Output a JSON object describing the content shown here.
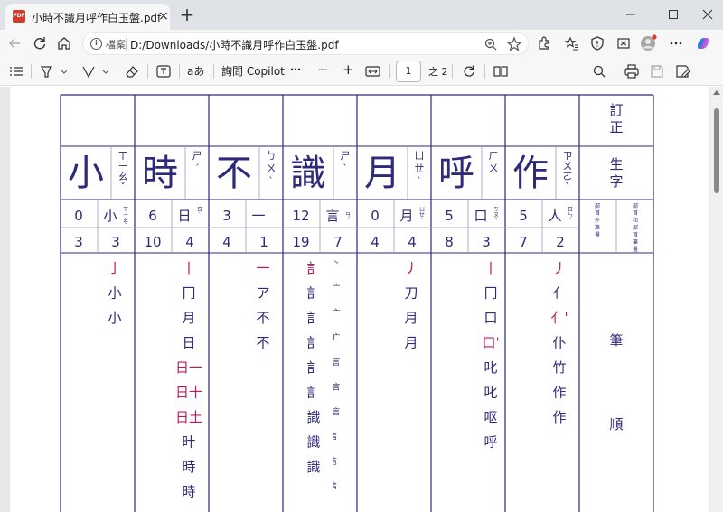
{
  "browser": {
    "tab_title": "小時不識月呼作白玉盤.pdf",
    "tab_icon": "pdf-icon",
    "new_tab_label": "+",
    "close_label": "×",
    "address_label": "檔案",
    "url": "D:/Downloads/小時不識月呼作白玉盤.pdf"
  },
  "pdf_toolbar": {
    "read_aloud_label": "aあ",
    "copilot_label": "詢問 Copilot",
    "more_label": "⋯",
    "zoom_out_label": "−",
    "zoom_in_label": "+",
    "page_number": "1",
    "page_total": "之 2"
  },
  "worksheet": {
    "corrections_header": "訂正",
    "new_chars_header": "生字",
    "radical_label_1": "部首外筆畫",
    "radical_label_2": "部首和部首筆畫",
    "stroke_order_label_1": "筆",
    "stroke_order_label_2": "順",
    "characters": [
      {
        "char": "作",
        "zhuyin": "ㄗㄨㄛˋ",
        "other_strokes": "5",
        "radical": "人",
        "radical_zhuyin": "ㄖㄣˊ",
        "total_strokes": "7",
        "radical_strokes": "2",
        "steps": [
          "丿",
          "亻",
          "亻'",
          "仆",
          "竹",
          "作",
          "作"
        ]
      },
      {
        "char": "呼",
        "zhuyin": "ㄏㄨ",
        "other_strokes": "5",
        "radical": "口",
        "radical_zhuyin": "ㄎㄡˇ",
        "total_strokes": "8",
        "radical_strokes": "3",
        "steps": [
          "丨",
          "冂",
          "口",
          "口'",
          "叱",
          "叱",
          "呕",
          "呼"
        ]
      },
      {
        "char": "月",
        "zhuyin": "ㄩㄝˋ",
        "other_strokes": "0",
        "radical": "月",
        "radical_zhuyin": "ㄩㄝˋ",
        "total_strokes": "4",
        "radical_strokes": "4",
        "steps": [
          "丿",
          "刀",
          "月",
          "月"
        ]
      },
      {
        "char": "識",
        "zhuyin": "ㄕˋ",
        "other_strokes": "12",
        "radical": "言",
        "radical_zhuyin": "ㄧㄢˊ",
        "total_strokes": "19",
        "radical_strokes": "7",
        "steps": [
          "訁",
          "訁",
          "訁",
          "訁",
          "訁",
          "訁",
          "識",
          "識",
          "識"
        ],
        "radical_steps": [
          "丶",
          "亠",
          "亠",
          "亡",
          "言",
          "言",
          "言",
          "訁",
          "訁",
          "訁"
        ]
      },
      {
        "char": "不",
        "zhuyin": "ㄅㄨˋ",
        "other_strokes": "3",
        "radical": "一",
        "radical_zhuyin": "ㄧ",
        "total_strokes": "4",
        "radical_strokes": "1",
        "steps": [
          "一",
          "ア",
          "不",
          "不"
        ]
      },
      {
        "char": "時",
        "zhuyin": "ㄕˊ",
        "other_strokes": "6",
        "radical": "日",
        "radical_zhuyin": "ㄖˋ",
        "total_strokes": "10",
        "radical_strokes": "4",
        "steps": [
          "丨",
          "冂",
          "月",
          "日",
          "日一",
          "日十",
          "日土",
          "旪",
          "時",
          "時"
        ]
      },
      {
        "char": "小",
        "zhuyin": "ㄒㄧㄠˇ",
        "other_strokes": "0",
        "radical": "小",
        "radical_zhuyin": "ㄒㄧㄠˇ",
        "total_strokes": "3",
        "radical_strokes": "3",
        "steps": [
          "亅",
          "小",
          "小"
        ]
      }
    ]
  }
}
